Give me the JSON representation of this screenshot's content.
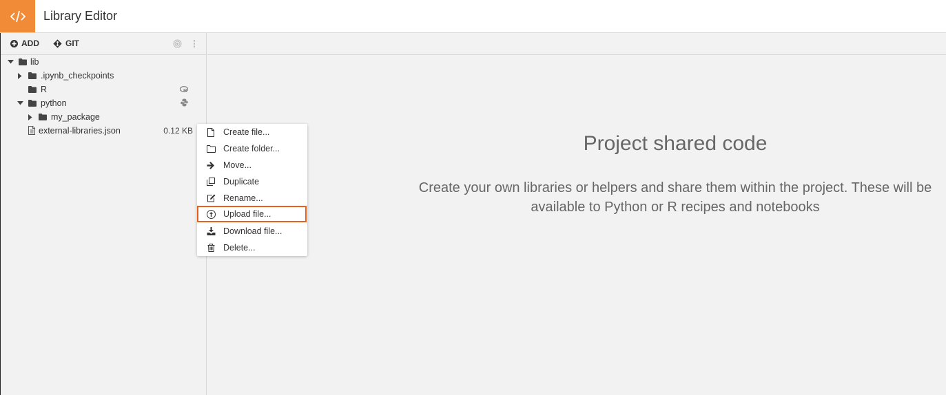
{
  "header": {
    "logo_icon": "code-icon",
    "title": "Library Editor",
    "accent_color": "#f28b37"
  },
  "sidebar": {
    "toolbar": {
      "add_label": "ADD",
      "git_label": "GIT"
    },
    "tree": [
      {
        "label": "lib",
        "type": "folder",
        "expanded": true,
        "depth": 0
      },
      {
        "label": ".ipynb_checkpoints",
        "type": "folder",
        "expanded": false,
        "depth": 1
      },
      {
        "label": "R",
        "type": "folder",
        "depth": 1,
        "badge_icon": "r-language-icon"
      },
      {
        "label": "python",
        "type": "folder",
        "expanded": true,
        "depth": 1,
        "badge_icon": "python-icon"
      },
      {
        "label": "my_package",
        "type": "folder",
        "expanded": false,
        "depth": 2
      },
      {
        "label": "external-libraries.json",
        "type": "file",
        "depth": 1,
        "size": "0.12 KB"
      }
    ]
  },
  "context_menu": {
    "items": [
      {
        "label": "Create file...",
        "icon": "file-icon"
      },
      {
        "label": "Create folder...",
        "icon": "folder-icon"
      },
      {
        "label": "Move...",
        "icon": "arrow-right-icon"
      },
      {
        "label": "Duplicate",
        "icon": "copy-icon"
      },
      {
        "label": "Rename...",
        "icon": "edit-icon"
      },
      {
        "label": "Upload file...",
        "icon": "upload-icon",
        "highlighted": true
      },
      {
        "label": "Download file...",
        "icon": "download-icon"
      },
      {
        "label": "Delete...",
        "icon": "trash-icon"
      }
    ],
    "highlight_color": "#e8601c"
  },
  "main": {
    "title": "Project shared code",
    "description": "Create your own libraries or helpers and share them within the project. These will be available to Python or R recipes and notebooks"
  }
}
